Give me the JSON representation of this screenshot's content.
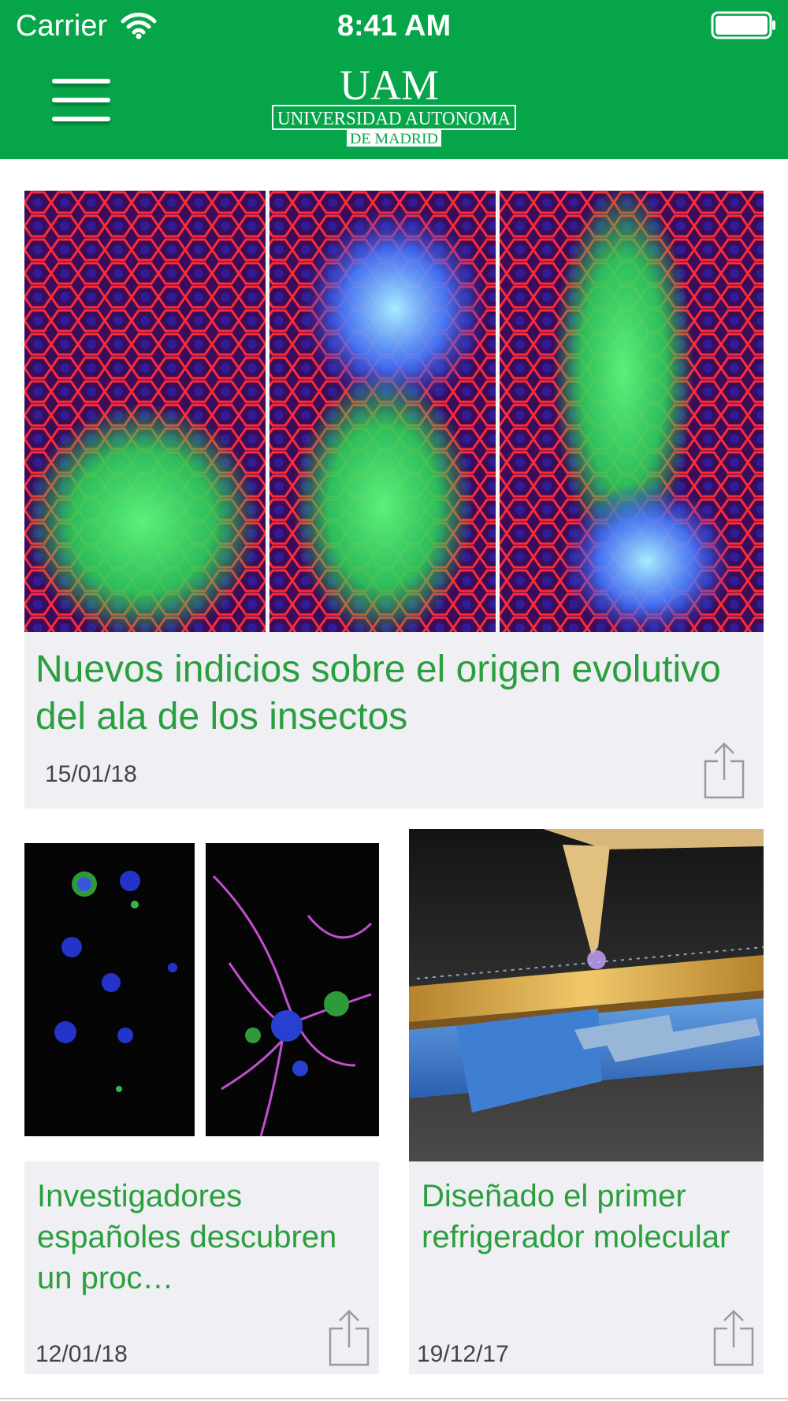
{
  "status_bar": {
    "carrier": "Carrier",
    "time": "8:41 AM",
    "wifi_icon": "wifi-icon",
    "battery_icon": "battery-full-icon"
  },
  "header": {
    "menu_icon": "hamburger-menu-icon",
    "logo": {
      "letters": "UAM",
      "name_line": "UNIVERSIDAD AUTONOMA",
      "city_line": "DE MADRID"
    },
    "color": "#07a54a"
  },
  "news": [
    {
      "title": "Nuevos indicios sobre el origen evolutivo del ala de los insectos",
      "date": "15/01/18",
      "image": "fluorescence-microscopy-cells",
      "share_icon": "share-icon"
    },
    {
      "title": "Investigadores españoles descubren un proc…",
      "date": "12/01/18",
      "image": "neurons-microscopy",
      "share_icon": "share-icon"
    },
    {
      "title": "Diseñado el primer refrigerador molecular",
      "date": "19/12/17",
      "image": "molecular-refrigerator-render",
      "share_icon": "share-icon"
    }
  ],
  "colors": {
    "title_green": "#2a9f3e",
    "card_background": "#efeff4"
  }
}
